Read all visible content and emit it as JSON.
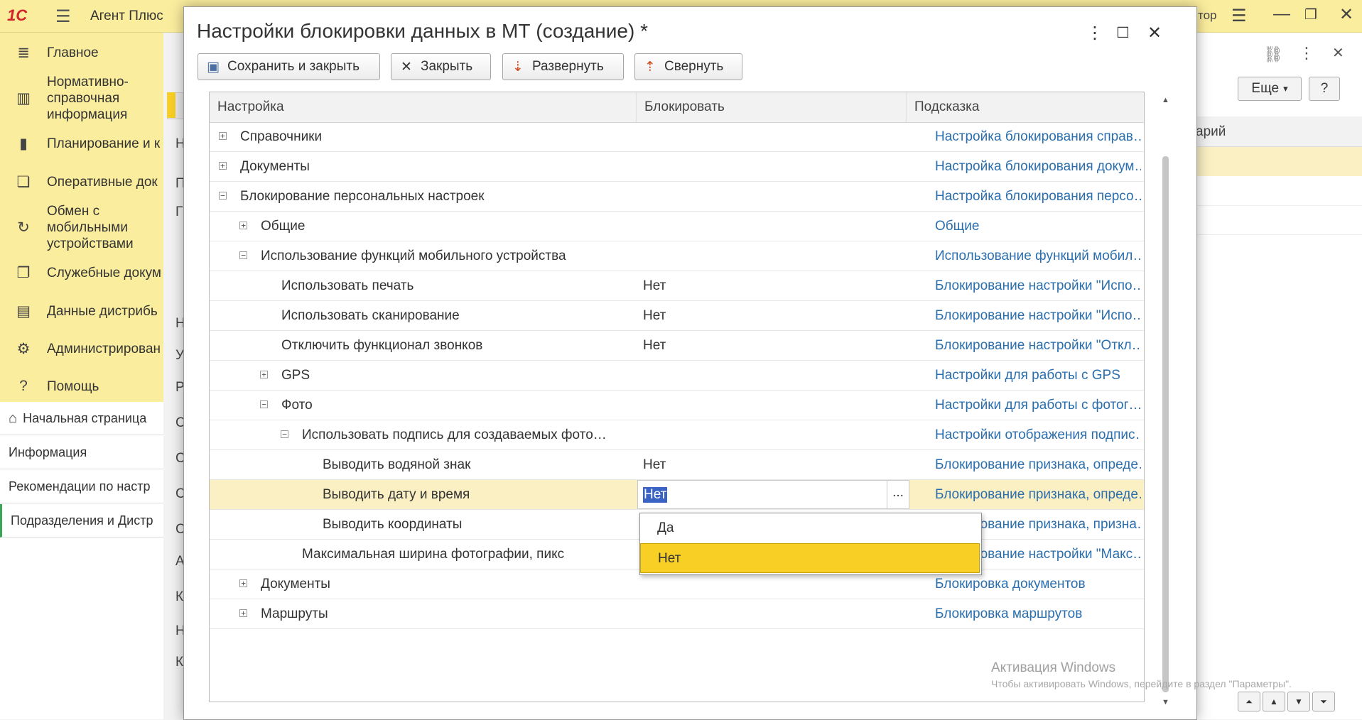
{
  "app": {
    "logo": "1С",
    "title": "Агент Плюс",
    "user_label": "тор"
  },
  "sidebar": {
    "items": [
      {
        "icon": "menu-lines-icon",
        "label": "Главное"
      },
      {
        "icon": "book-icon",
        "label": "Нормативно-справочная информация"
      },
      {
        "icon": "bar-chart-icon",
        "label": "Планирование и к"
      },
      {
        "icon": "documents-icon",
        "label": "Оперативные док"
      },
      {
        "icon": "sync-icon",
        "label": "Обмен с мобильными устройствами"
      },
      {
        "icon": "service-docs-icon",
        "label": "Служебные докум"
      },
      {
        "icon": "distrib-icon",
        "label": "Данные дистрибь"
      },
      {
        "icon": "gear-icon",
        "label": "Администрирован"
      },
      {
        "icon": "question-icon",
        "label": "Помощь"
      }
    ]
  },
  "open_windows": [
    {
      "label": "Начальная страница"
    },
    {
      "label": "Информация"
    },
    {
      "label": "Рекомендации по настр"
    },
    {
      "label": "Подразделения и Дистр"
    }
  ],
  "background_letters": [
    "Н",
    "П",
    "Г",
    "Н",
    "У",
    "Р",
    "С",
    "С",
    "С",
    "С",
    "А",
    "К",
    "Н",
    "К"
  ],
  "right_panel": {
    "more_button": "Еще",
    "more_arrow": "▾",
    "help_button": "?",
    "column_label": "арий"
  },
  "dialog": {
    "title": "Настройки блокировки данных в МТ (создание) *",
    "toolbar": {
      "save_close": "Сохранить и закрыть",
      "close": "Закрыть",
      "expand": "Развернуть",
      "collapse": "Свернуть"
    },
    "columns": {
      "setting": "Настройка",
      "block": "Блокировать",
      "hint": "Подсказка"
    },
    "rows": [
      {
        "name": "Справочники",
        "value": "",
        "hint": "Настройка блокирования справ…",
        "level": 0,
        "toggle": "+"
      },
      {
        "name": "Документы",
        "value": "",
        "hint": "Настройка блокирования докум…",
        "level": 0,
        "toggle": "+"
      },
      {
        "name": "Блокирование персональных настроек",
        "value": "",
        "hint": "Настройка блокирования персо…",
        "level": 0,
        "toggle": "−"
      },
      {
        "name": "Общие",
        "value": "",
        "hint": "Общие",
        "level": 1,
        "toggle": "+"
      },
      {
        "name": "Использование функций мобильного устройства",
        "value": "",
        "hint": "Использование функций мобил…",
        "level": 1,
        "toggle": "−"
      },
      {
        "name": "Использовать печать",
        "value": "Нет",
        "hint": "Блокирование настройки \"Испо…",
        "level": 2,
        "toggle": ""
      },
      {
        "name": "Использовать сканирование",
        "value": "Нет",
        "hint": "Блокирование настройки \"Испо…",
        "level": 2,
        "toggle": ""
      },
      {
        "name": "Отключить функционал звонков",
        "value": "Нет",
        "hint": "Блокирование настройки \"Откл…",
        "level": 2,
        "toggle": ""
      },
      {
        "name": "GPS",
        "value": "",
        "hint": "Настройки для работы с GPS",
        "level": 2,
        "toggle": "+"
      },
      {
        "name": "Фото",
        "value": "",
        "hint": "Настройки для работы с фотог…",
        "level": 2,
        "toggle": "−"
      },
      {
        "name": "Использовать подпись для создаваемых фото…",
        "value": "",
        "hint": "Настройки отображения подпис…",
        "level": 3,
        "toggle": "−"
      },
      {
        "name": "Выводить водяной знак",
        "value": "Нет",
        "hint": "Блокирование признака, опреде…",
        "level": 4,
        "toggle": ""
      },
      {
        "name": "Выводить дату и время",
        "value": "Нет",
        "hint": "Блокирование признака, опреде…",
        "level": 4,
        "toggle": "",
        "selected": true
      },
      {
        "name": "Выводить координаты",
        "value": "",
        "hint": "Блокирование признака, призна…",
        "level": 4,
        "toggle": ""
      },
      {
        "name": "Максимальная ширина фотографии, пикс",
        "value": "",
        "hint": "Блокирование настройки \"Макс…",
        "level": 3,
        "toggle": ""
      },
      {
        "name": "Документы",
        "value": "",
        "hint": "Блокировка документов",
        "level": 1,
        "toggle": "+"
      },
      {
        "name": "Маршруты",
        "value": "",
        "hint": "Блокировка маршрутов",
        "level": 1,
        "toggle": "+"
      }
    ],
    "dropdown_options": [
      {
        "label": "Да",
        "highlighted": false
      },
      {
        "label": "Нет",
        "highlighted": true
      }
    ],
    "edit_ellipsis": "..."
  },
  "watermark": {
    "line1": "Активация Windows",
    "line2": "Чтобы активировать Windows, перейдите в раздел \"Параметры\"."
  }
}
